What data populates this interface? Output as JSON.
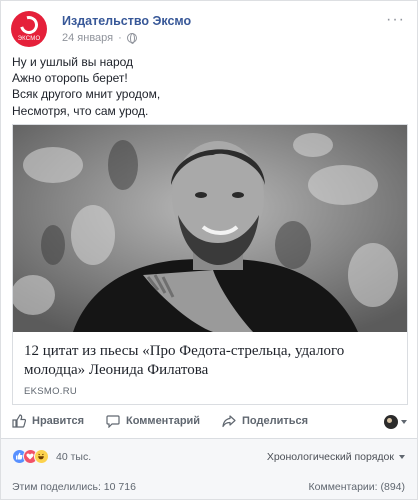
{
  "post": {
    "page_name": "Издательство Эксмо",
    "avatar_text": "ЭКСМО",
    "date": "24 января",
    "lines": [
      "Ну и ушлый вы народ",
      "Ажно оторопь берет!",
      "Всяк другого мнит уродом,",
      "Несмотря, что сам урод."
    ]
  },
  "link_card": {
    "title": "12 цитат из пьесы «Про Федота-стрельца, удалого молодца» Леонида Филатова",
    "domain": "EKSMO.RU"
  },
  "actions": {
    "like": "Нравится",
    "comment": "Комментарий",
    "share": "Поделиться"
  },
  "stats": {
    "reactions_count": "40 тыс.",
    "sort_label": "Хронологический порядок",
    "shares": "Этим поделились: 10 716",
    "comments": "Комментарии: (894)"
  },
  "colors": {
    "brand_red": "#e5203a",
    "link_blue": "#385898",
    "like_blue": "#5890ff"
  }
}
